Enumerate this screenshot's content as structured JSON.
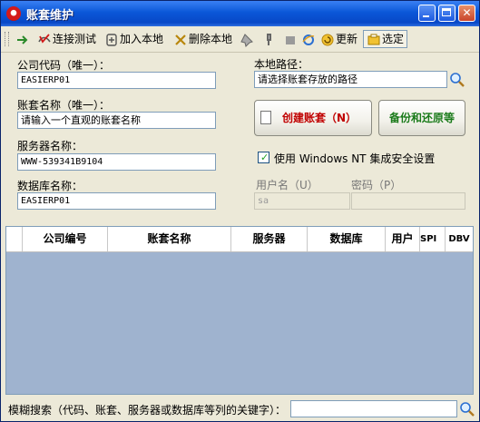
{
  "window": {
    "title": "账套维护"
  },
  "toolbar": {
    "test_connection": "连接测试",
    "add_local": "加入本地",
    "delete_local": "删除本地",
    "update": "更新",
    "select": "选定"
  },
  "form": {
    "company_code_label": "公司代码（唯一）：",
    "company_code_value": "EASIERP01",
    "account_name_label": "账套名称（唯一）：",
    "account_name_value": "请输入一个直观的账套名称",
    "server_label": "服务器名称：",
    "server_value": "WWW-539341B9104",
    "database_label": "数据库名称：",
    "database_value": "EASIERP01",
    "local_path_label": "本地路径：",
    "local_path_value": "请选择账套存放的路径",
    "create_button": "创建账套（N）",
    "backup_button": "备份和还原等",
    "windows_nt_label": "使用 Windows NT 集成安全设置",
    "windows_nt_checked": true,
    "username_label": "用户名（U）",
    "username_value": "sa",
    "password_label": "密码（P）"
  },
  "table": {
    "columns": [
      "公司编号",
      "账套名称",
      "服务器",
      "数据库",
      "用户",
      "SPI",
      "DBV"
    ]
  },
  "search": {
    "label": "模糊搜索（代码、账套、服务器或数据库等列的关键字）："
  },
  "colors": {
    "title_bar": "#0a57d8",
    "grid_background": "#9fb3cf",
    "create_text": "#c00000",
    "backup_text": "#1a7a1a"
  }
}
